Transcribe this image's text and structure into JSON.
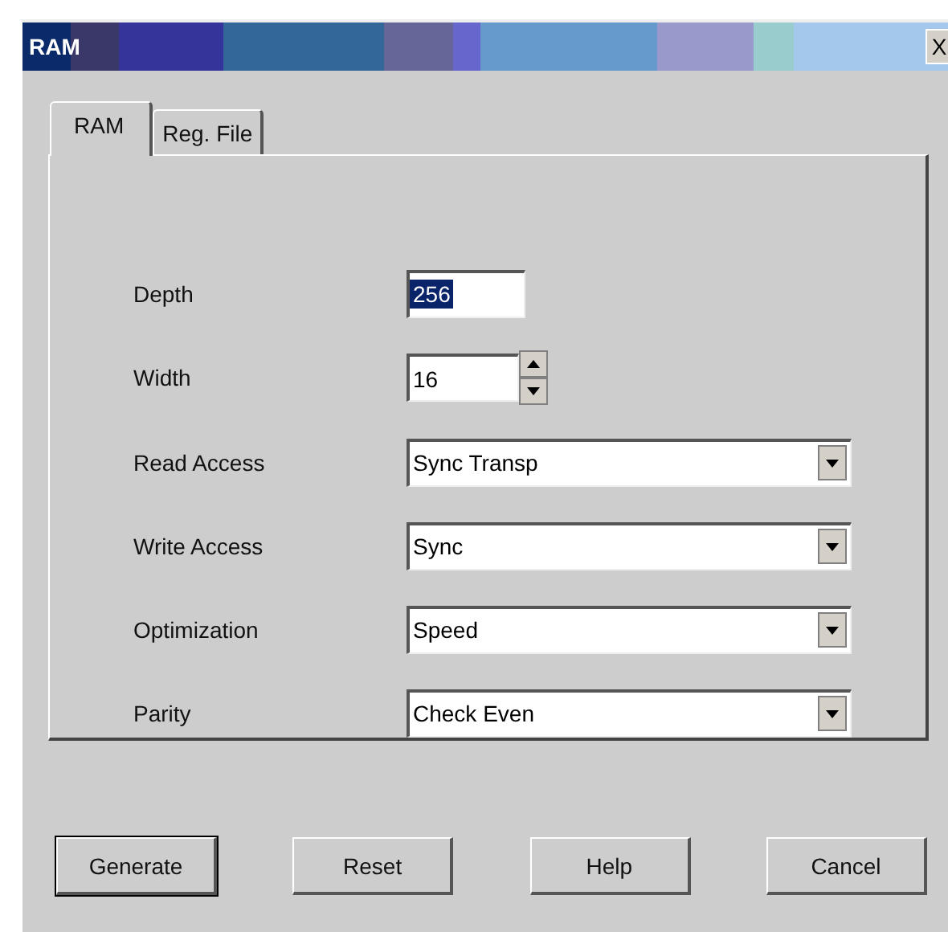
{
  "window": {
    "title": "RAM",
    "close": "X"
  },
  "tabs": [
    {
      "label": "RAM",
      "selected": true
    },
    {
      "label": "Reg. File",
      "selected": false
    }
  ],
  "fields": [
    {
      "kind": "text",
      "label": "Depth",
      "value": "256",
      "highlighted": true
    },
    {
      "kind": "spinner",
      "label": "Width",
      "value": "16",
      "highlighted": false
    },
    {
      "kind": "dropdown",
      "label": "Read Access",
      "value": "Sync Transp"
    },
    {
      "kind": "dropdown",
      "label": "Write Access",
      "value": "Sync"
    },
    {
      "kind": "dropdown",
      "label": "Optimization",
      "value": "Speed"
    },
    {
      "kind": "dropdown",
      "label": "Parity",
      "value": "Check Even"
    }
  ],
  "buttons": [
    {
      "label": "Generate",
      "default": true
    },
    {
      "label": "Reset",
      "default": false
    },
    {
      "label": "Help",
      "default": false
    },
    {
      "label": "Cancel",
      "default": false
    }
  ]
}
